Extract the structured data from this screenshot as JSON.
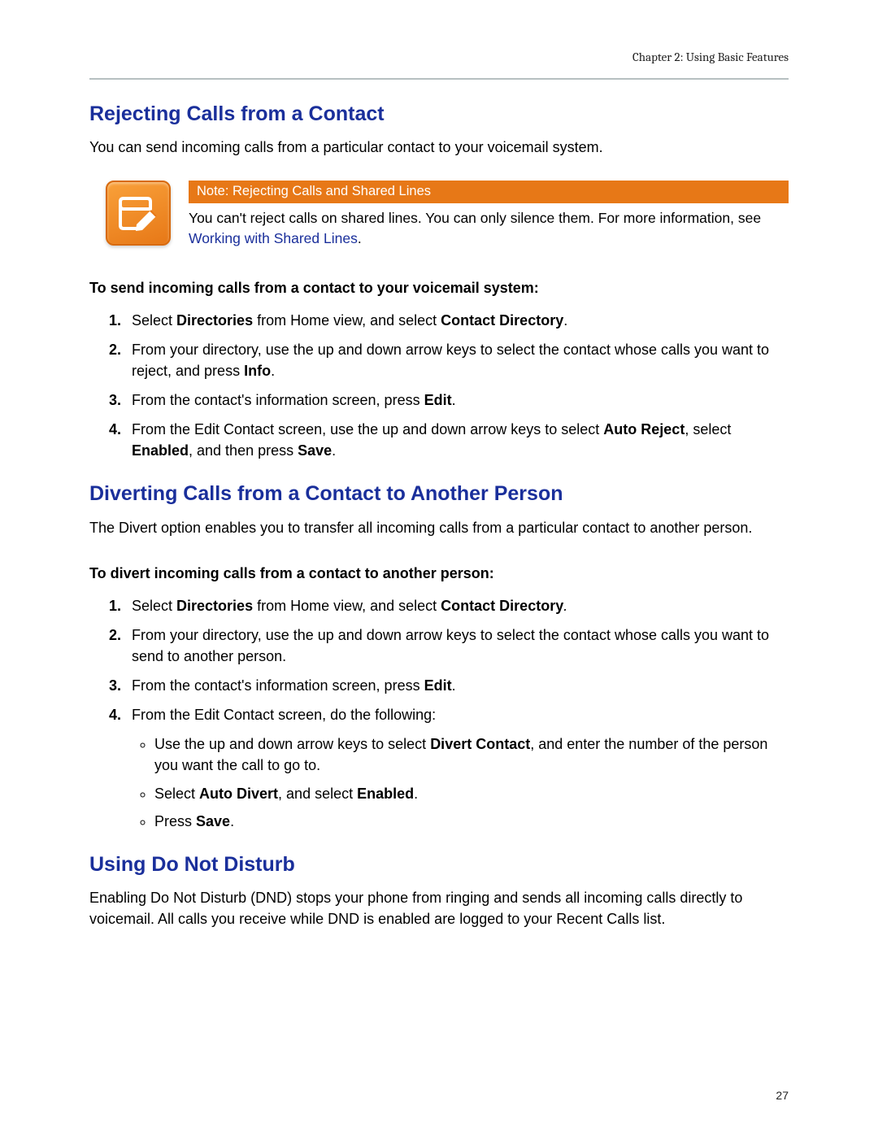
{
  "header": {
    "chapter": "Chapter 2: Using Basic Features"
  },
  "section1": {
    "title": "Rejecting Calls from a Contact",
    "intro": "You can send incoming calls from a particular contact to your voicemail system.",
    "note": {
      "title": "Note: Rejecting Calls and Shared Lines",
      "text_before_link": "You can't reject calls on shared lines. You can only silence them. For more information, see ",
      "link_text": "Working with Shared Lines",
      "text_after_link": ".",
      "icon_name": "note-pencil-icon"
    },
    "task_title": "To send incoming calls from a contact to your voicemail system:",
    "steps": {
      "s1_a": "Select ",
      "s1_b": "Directories",
      "s1_c": " from Home view, and select ",
      "s1_d": "Contact Directory",
      "s1_e": ".",
      "s2_a": "From your directory, use the up and down arrow keys to select the contact whose calls you want to reject, and press ",
      "s2_b": "Info",
      "s2_c": ".",
      "s3_a": "From the contact's information screen, press ",
      "s3_b": "Edit",
      "s3_c": ".",
      "s4_a": "From the Edit Contact screen, use the up and down arrow keys to select ",
      "s4_b": "Auto Reject",
      "s4_c": ", select ",
      "s4_d": "Enabled",
      "s4_e": ", and then press ",
      "s4_f": "Save",
      "s4_g": "."
    }
  },
  "section2": {
    "title": "Diverting Calls from a Contact to Another Person",
    "intro": "The Divert option enables you to transfer all incoming calls from a particular contact to another person.",
    "task_title": "To divert incoming calls from a contact to another person:",
    "steps": {
      "s1_a": "Select ",
      "s1_b": "Directories",
      "s1_c": " from Home view, and select ",
      "s1_d": "Contact Directory",
      "s1_e": ".",
      "s2": "From your directory, use the up and down arrow keys to select the contact whose calls you want to send to another person.",
      "s3_a": "From the contact's information screen, press ",
      "s3_b": "Edit",
      "s3_c": ".",
      "s4": "From the Edit Contact screen, do the following:",
      "sub": {
        "a1": "Use the up and down arrow keys to select ",
        "a2": "Divert Contact",
        "a3": ", and enter the number of the person you want the call to go to.",
        "b1": "Select ",
        "b2": "Auto Divert",
        "b3": ", and select ",
        "b4": "Enabled",
        "b5": ".",
        "c1": "Press ",
        "c2": "Save",
        "c3": "."
      }
    }
  },
  "section3": {
    "title": "Using Do Not Disturb",
    "intro": "Enabling Do Not Disturb (DND) stops your phone from ringing and sends all incoming calls directly to voicemail. All calls you receive while DND is enabled are logged to your Recent Calls list."
  },
  "page_number": "27"
}
